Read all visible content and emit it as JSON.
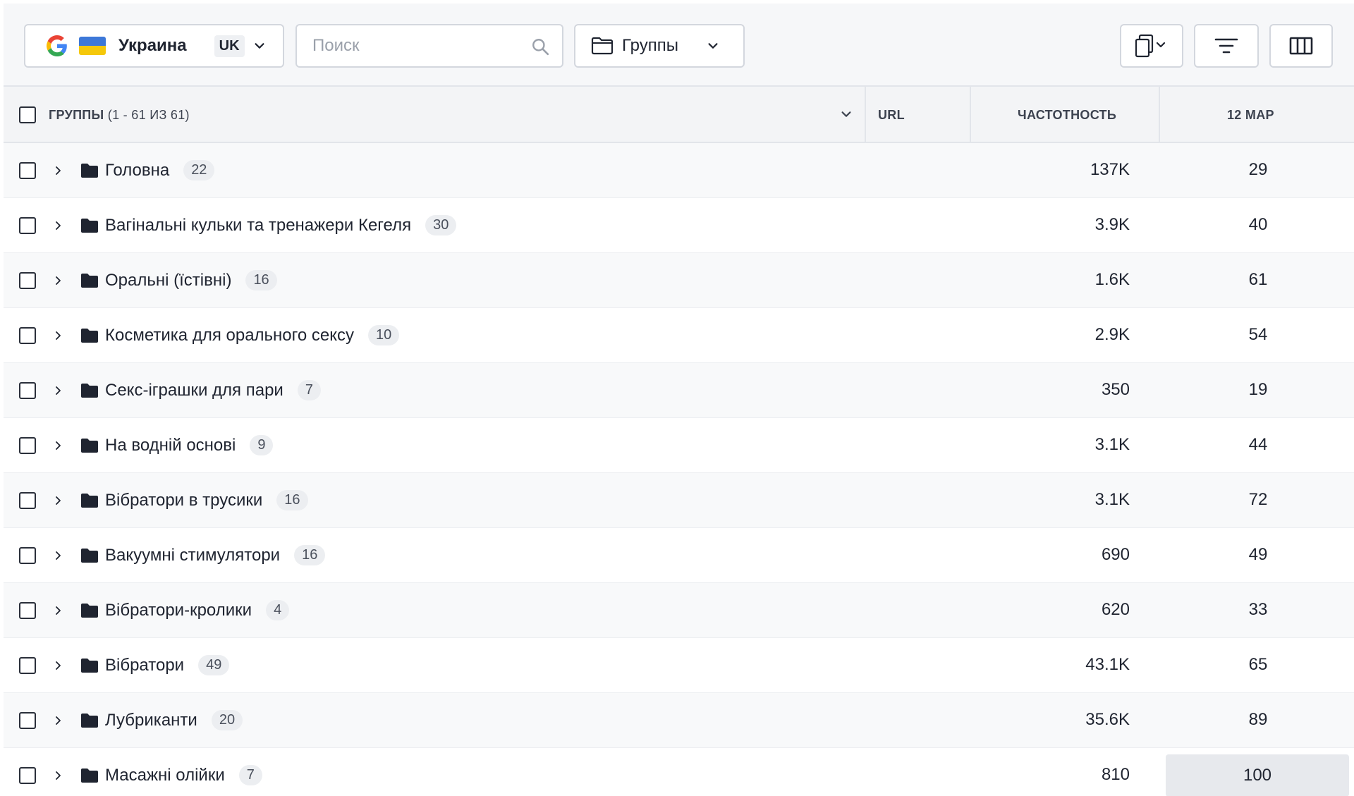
{
  "toolbar": {
    "region": {
      "name": "Украина",
      "lang": "UK"
    },
    "search": {
      "placeholder": "Поиск",
      "value": ""
    },
    "groups": {
      "label": "Группы"
    }
  },
  "table": {
    "header": {
      "groups_label": "ГРУППЫ",
      "groups_range": "(1 - 61 ИЗ 61)",
      "url": "URL",
      "frequency": "ЧАСТОТНОСТЬ",
      "date": "12 МАР"
    },
    "rows": [
      {
        "name": "Головна",
        "count": "22",
        "frequency": "137K",
        "position": "29"
      },
      {
        "name": "Вагінальні кульки та тренажери Кегеля",
        "count": "30",
        "frequency": "3.9K",
        "position": "40"
      },
      {
        "name": "Оральні (їстівні)",
        "count": "16",
        "frequency": "1.6K",
        "position": "61"
      },
      {
        "name": "Косметика для орального сексу",
        "count": "10",
        "frequency": "2.9K",
        "position": "54"
      },
      {
        "name": "Секс-іграшки для пари",
        "count": "7",
        "frequency": "350",
        "position": "19"
      },
      {
        "name": "На водній основі",
        "count": "9",
        "frequency": "3.1K",
        "position": "44"
      },
      {
        "name": "Вібратори в трусики",
        "count": "16",
        "frequency": "3.1K",
        "position": "72"
      },
      {
        "name": "Вакуумні стимулятори",
        "count": "16",
        "frequency": "690",
        "position": "49"
      },
      {
        "name": "Вібратори-кролики",
        "count": "4",
        "frequency": "620",
        "position": "33"
      },
      {
        "name": "Вібратори",
        "count": "49",
        "frequency": "43.1K",
        "position": "65"
      },
      {
        "name": "Лубриканти",
        "count": "20",
        "frequency": "35.6K",
        "position": "89"
      },
      {
        "name": "Масажні олійки",
        "count": "7",
        "frequency": "810",
        "position": "100"
      }
    ]
  },
  "icons": {
    "search": "search-icon",
    "folder": "folder-icon",
    "copy": "copy-icon",
    "filter": "filter-icon",
    "columns": "columns-icon",
    "chevron": "chevron-down-icon",
    "chevron_right": "chevron-right-icon"
  },
  "colors": {
    "flag_blue": "#3d78d8",
    "flag_yellow": "#f5c80a",
    "toolbar_bg": "#f6f7f9",
    "header_bg": "#f3f4f6"
  }
}
